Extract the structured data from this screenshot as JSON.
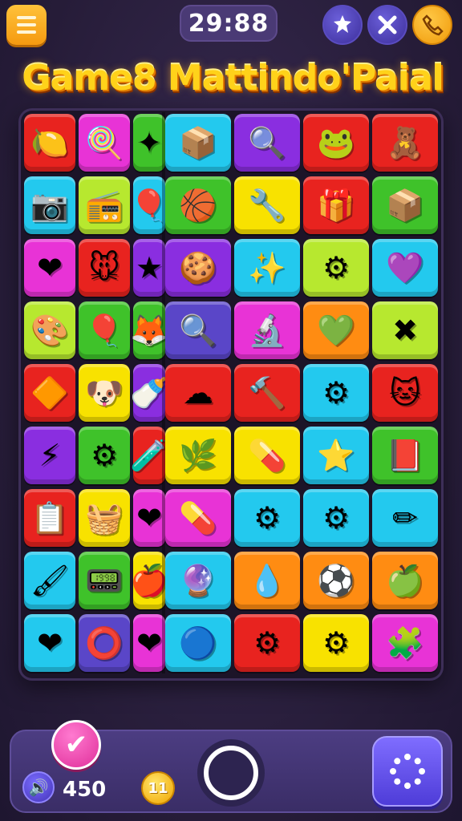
{
  "header": {
    "timer": "29:88",
    "title": "Game8 Mattindo'Paial"
  },
  "icons": {
    "menu": "menu-icon",
    "puzzle": "puzzle-icon",
    "shuffle": "shuffle-icon",
    "phone": "phone-icon"
  },
  "colors": {
    "red": "#e8231f",
    "magenta": "#e833d6",
    "green": "#3fc22a",
    "cyan": "#23c9ee",
    "purple": "#8a2ee0",
    "yellow": "#f8e200",
    "orange": "#ff8c12",
    "lime": "#b7e82f",
    "violet": "#5a46c8"
  },
  "board": {
    "rows": [
      [
        {
          "c": "red",
          "g": "🍋",
          "n": "lemon"
        },
        {
          "c": "magenta",
          "g": "🍭",
          "n": "lollipop"
        },
        {
          "c": "green",
          "g": "✦",
          "n": "star"
        },
        {
          "c": "cyan",
          "g": "📦",
          "n": "box"
        },
        {
          "c": "purple",
          "g": "🔍",
          "n": "magnifier"
        },
        {
          "c": "red",
          "g": "🐸",
          "n": "frog"
        },
        {
          "c": "red",
          "g": "🧸",
          "n": "toy"
        }
      ],
      [
        {
          "c": "cyan",
          "g": "📷",
          "n": "camera"
        },
        {
          "c": "lime",
          "g": "📻",
          "n": "radio"
        },
        {
          "c": "cyan",
          "g": "🎈",
          "n": "balloon"
        },
        {
          "c": "green",
          "g": "🏀",
          "n": "ball"
        },
        {
          "c": "yellow",
          "g": "🔧",
          "n": "wand"
        },
        {
          "c": "red",
          "g": "🎁",
          "n": "gift"
        },
        {
          "c": "green",
          "g": "📦",
          "n": "crate"
        }
      ],
      [
        {
          "c": "magenta",
          "g": "❤",
          "n": "heart"
        },
        {
          "c": "red",
          "g": "🐭",
          "n": "mouse"
        },
        {
          "c": "purple",
          "g": "★",
          "n": "star"
        },
        {
          "c": "purple",
          "g": "🍪",
          "n": "cookie"
        },
        {
          "c": "cyan",
          "g": "✨",
          "n": "magic-wand"
        },
        {
          "c": "lime",
          "g": "⚙",
          "n": "gear"
        },
        {
          "c": "cyan",
          "g": "💜",
          "n": "purple-heart"
        }
      ],
      [
        {
          "c": "lime",
          "g": "🎨",
          "n": "palette"
        },
        {
          "c": "green",
          "g": "🎈",
          "n": "balloons"
        },
        {
          "c": "green",
          "g": "🦊",
          "n": "fox"
        },
        {
          "c": "violet",
          "g": "🔍",
          "n": "search"
        },
        {
          "c": "magenta",
          "g": "🔬",
          "n": "scope"
        },
        {
          "c": "orange",
          "g": "💚",
          "n": "heart"
        },
        {
          "c": "lime",
          "g": "✖",
          "n": "splat"
        }
      ],
      [
        {
          "c": "red",
          "g": "🔶",
          "n": "gem"
        },
        {
          "c": "yellow",
          "g": "🐶",
          "n": "dog"
        },
        {
          "c": "purple",
          "g": "🍼",
          "n": "bottle"
        },
        {
          "c": "red",
          "g": "☁",
          "n": "cloud"
        },
        {
          "c": "red",
          "g": "🔨",
          "n": "hammer"
        },
        {
          "c": "cyan",
          "g": "⚙",
          "n": "gear"
        },
        {
          "c": "red",
          "g": "🐱",
          "n": "cat"
        }
      ],
      [
        {
          "c": "purple",
          "g": "⚡",
          "n": "bolt"
        },
        {
          "c": "green",
          "g": "⚙",
          "n": "cog"
        },
        {
          "c": "red",
          "g": "🧪",
          "n": "tube"
        },
        {
          "c": "yellow",
          "g": "🌿",
          "n": "leaf"
        },
        {
          "c": "yellow",
          "g": "💊",
          "n": "capsule"
        },
        {
          "c": "cyan",
          "g": "⭐",
          "n": "star"
        },
        {
          "c": "green",
          "g": "📕",
          "n": "book"
        }
      ],
      [
        {
          "c": "red",
          "g": "📋",
          "n": "board"
        },
        {
          "c": "yellow",
          "g": "🧺",
          "n": "basket"
        },
        {
          "c": "magenta",
          "g": "❤",
          "n": "heart"
        },
        {
          "c": "magenta",
          "g": "💊",
          "n": "pill"
        },
        {
          "c": "cyan",
          "g": "⚙",
          "n": "gear"
        },
        {
          "c": "cyan",
          "g": "⚙",
          "n": "cog"
        },
        {
          "c": "cyan",
          "g": "✏",
          "n": "pencil"
        }
      ],
      [
        {
          "c": "cyan",
          "g": "🖌",
          "n": "brush"
        },
        {
          "c": "green",
          "g": "📟",
          "n": "device"
        },
        {
          "c": "yellow",
          "g": "🍎",
          "n": "apple"
        },
        {
          "c": "cyan",
          "g": "🔮",
          "n": "orb"
        },
        {
          "c": "orange",
          "g": "💧",
          "n": "drop"
        },
        {
          "c": "orange",
          "g": "⚽",
          "n": "ball"
        },
        {
          "c": "orange",
          "g": "🍏",
          "n": "leaf"
        }
      ],
      [
        {
          "c": "cyan",
          "g": "❤",
          "n": "heart"
        },
        {
          "c": "violet",
          "g": "⭕",
          "n": "ring"
        },
        {
          "c": "magenta",
          "g": "❤",
          "n": "heart"
        },
        {
          "c": "cyan",
          "g": "🔵",
          "n": "bubble"
        },
        {
          "c": "red",
          "g": "⚙",
          "n": "gear"
        },
        {
          "c": "yellow",
          "g": "⚙",
          "n": "gear"
        },
        {
          "c": "magenta",
          "g": "🧩",
          "n": "block"
        }
      ]
    ]
  },
  "footer": {
    "check": "✔",
    "hint": "🔊",
    "score": "450",
    "coin": "11"
  }
}
